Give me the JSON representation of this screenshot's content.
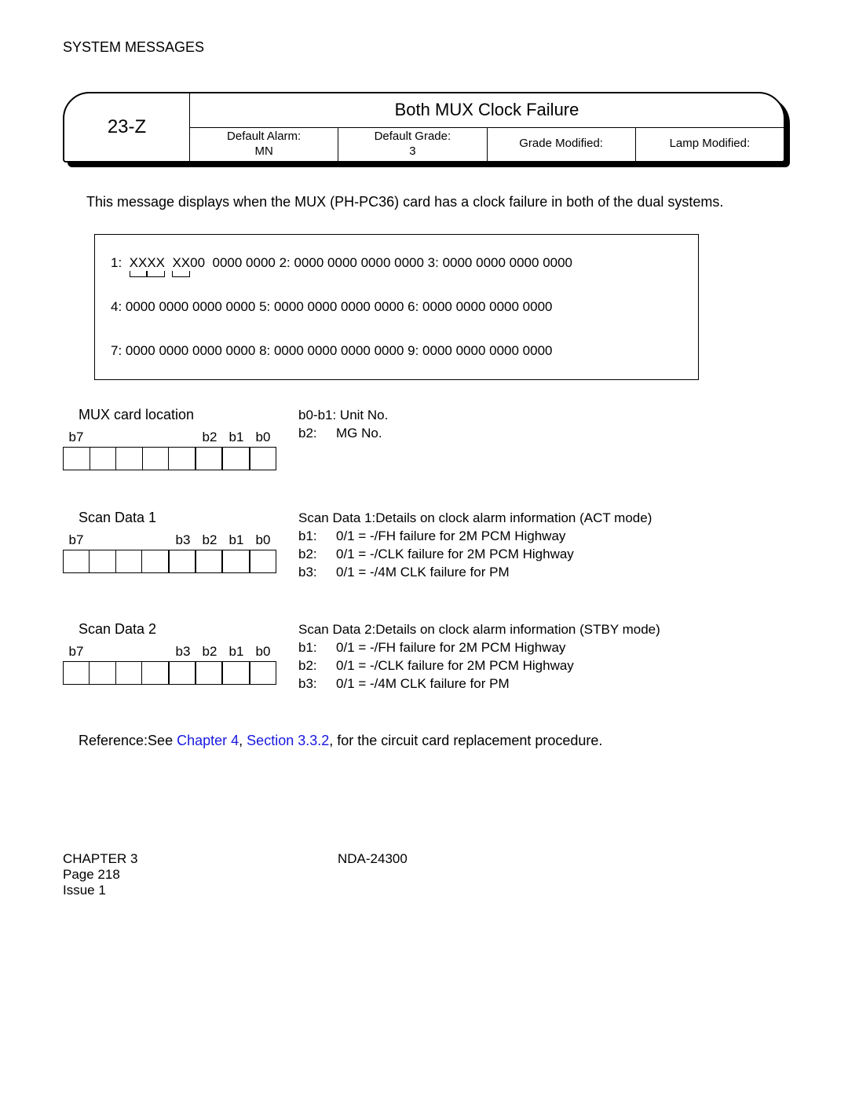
{
  "header": "SYSTEM MESSAGES",
  "msg": {
    "code": "23-Z",
    "title": "Both MUX Clock Failure",
    "alarm_label": "Default Alarm:",
    "alarm_value": "MN",
    "grade_label": "Default Grade:",
    "grade_value": "3",
    "gmod_label": "Grade Modified:",
    "lmod_label": "Lamp Modified:"
  },
  "description": "This message displays when the MUX (PH-PC36) card has a clock failure in both of the dual systems.",
  "rows": {
    "r1a": "1:",
    "r1b": "XXXX",
    "r1c": "XX",
    "r1d": "00",
    "r1e": "0000  0000  2:  0000  0000  0000  0000  3:  0000  0000  0000  0000",
    "r2": "4:  0000  0000  0000  0000  5:  0000  0000  0000  0000  6:  0000  0000  0000  0000",
    "r3": "7:  0000  0000  0000  0000  8:  0000  0000  0000  0000  9:  0000  0000  0000  0000"
  },
  "mux": {
    "title": "MUX card location",
    "right1": "b0-b1: Unit No.",
    "right2_k": "b2:",
    "right2_v": "MG No.",
    "b7": "b7",
    "b2": "b2",
    "b1": "b1",
    "b0": "b0"
  },
  "sd1": {
    "title": "Scan Data 1",
    "heading": "Scan Data 1:Details on clock alarm information (ACT mode)",
    "l1k": "b1:",
    "l1v": "0/1 = -/FH failure for 2M PCM Highway",
    "l2k": "b2:",
    "l2v": "0/1 = -/CLK failure for 2M PCM Highway",
    "l3k": "b3:",
    "l3v": "0/1 = -/4M CLK failure for PM",
    "b7": "b7",
    "b3": "b3",
    "b2": "b2",
    "b1": "b1",
    "b0": "b0"
  },
  "sd2": {
    "title": "Scan Data 2",
    "heading": "Scan Data 2:Details on clock alarm information (STBY mode)",
    "l1k": "b1:",
    "l1v": "0/1 = -/FH failure for 2M PCM Highway",
    "l2k": "b2:",
    "l2v": "0/1 = -/CLK failure for 2M PCM Highway",
    "l3k": "b3:",
    "l3v": "0/1 = -/4M CLK failure for PM",
    "b7": "b7",
    "b3": "b3",
    "b2": "b2",
    "b1": "b1",
    "b0": "b0"
  },
  "reference": {
    "prefix": "Reference:See",
    "link1": "Chapter 4",
    "link2": "Section 3.3.2",
    "suffix": "for the circuit card replacement procedure."
  },
  "footer": {
    "chapter": "CHAPTER 3",
    "doc": "NDA-24300",
    "page": "Page 218",
    "issue": "Issue 1"
  }
}
